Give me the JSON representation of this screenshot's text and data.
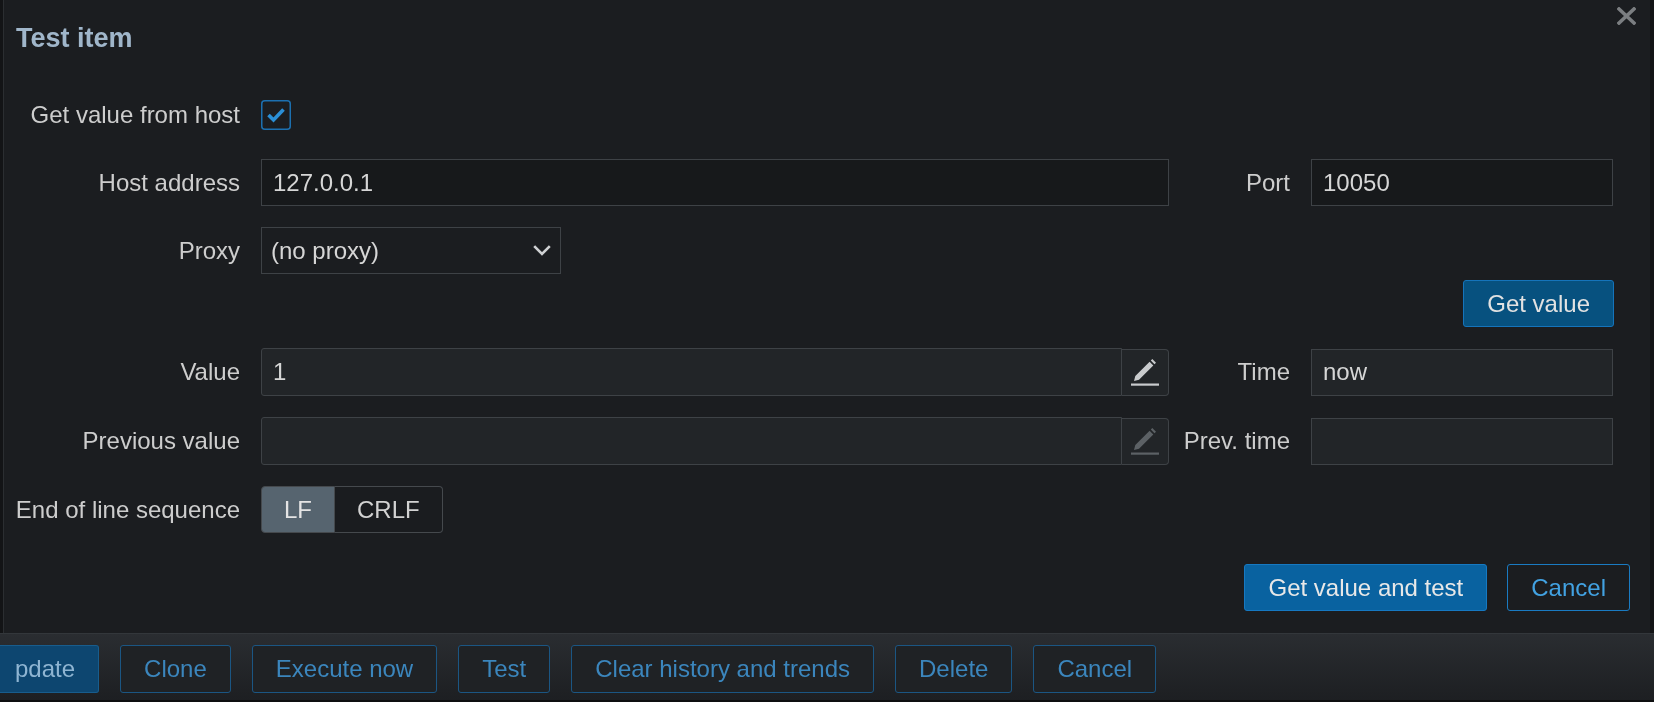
{
  "dialog": {
    "title": "Test item",
    "get_value_from_host": {
      "label": "Get value from host",
      "checked": true
    },
    "host_address": {
      "label": "Host address",
      "value": "127.0.0.1",
      "readonly": false
    },
    "port": {
      "label": "Port",
      "value": "10050",
      "readonly": false
    },
    "proxy": {
      "label": "Proxy",
      "value": "(no proxy)"
    },
    "get_value_button": "Get value",
    "value": {
      "label": "Value",
      "value": "1",
      "readonly": true,
      "edit_disabled": false
    },
    "time": {
      "label": "Time",
      "value": "now",
      "readonly": true
    },
    "previous_value": {
      "label": "Previous value",
      "readonly": true,
      "edit_disabled": true
    },
    "prev_time": {
      "label": "Prev. time",
      "readonly": true
    },
    "end_of_line_sequence": {
      "label": "End of line sequence",
      "options": [
        {
          "label": "LF",
          "selected": true
        },
        {
          "label": "CRLF",
          "selected": false
        }
      ]
    },
    "buttons": [
      {
        "label": "Get value and test",
        "kind": "primary"
      },
      {
        "label": "Cancel",
        "kind": "secondary"
      }
    ]
  },
  "form_buttons": [
    {
      "label": "pdate",
      "kind": "primary"
    },
    {
      "label": "Clone",
      "kind": "secondary"
    },
    {
      "label": "Execute now",
      "kind": "secondary"
    },
    {
      "label": "Test",
      "kind": "secondary"
    },
    {
      "label": "Clear history and trends",
      "kind": "secondary"
    },
    {
      "label": "Delete",
      "kind": "secondary"
    },
    {
      "label": "Cancel",
      "kind": "secondary"
    }
  ]
}
